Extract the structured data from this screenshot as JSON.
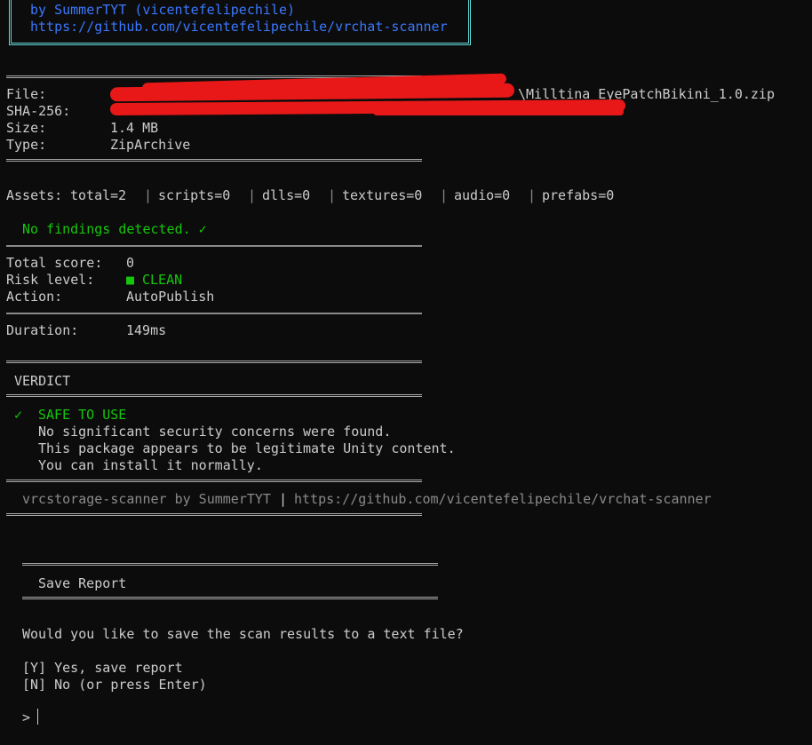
{
  "banner": {
    "author_line": "by SummerTYT (vicentefelipechile)",
    "repo_url": "https://github.com/vicentefelipechile/vrchat-scanner"
  },
  "file_info": {
    "file_label": "File:",
    "file_value": "\\Milltina_EyePatchBikini_1.0.zip",
    "sha_label": "SHA-256:",
    "size_label": "Size:",
    "size_value": "1.4 MB",
    "type_label": "Type:",
    "type_value": "ZipArchive"
  },
  "assets": {
    "label": "Assets:",
    "items": [
      "total=2",
      "scripts=0",
      "dlls=0",
      "textures=0",
      "audio=0",
      "prefabs=0"
    ]
  },
  "findings": {
    "text": "No findings detected. ✓"
  },
  "score": {
    "total_label": "Total score:",
    "total_value": "0",
    "risk_label": "Risk level:",
    "risk_marker": "■",
    "risk_value": "CLEAN",
    "action_label": "Action:",
    "action_value": "AutoPublish",
    "duration_label": "Duration:",
    "duration_value": "149ms"
  },
  "verdict": {
    "heading": "VERDICT",
    "check": "✓",
    "title": "SAFE TO USE",
    "lines": [
      "No significant security concerns were found.",
      "This package appears to be legitimate Unity content.",
      "You can install it normally."
    ]
  },
  "footer": {
    "tool": "vrcstorage-scanner by SummerTYT",
    "separator": "|",
    "url": "https://github.com/vicentefelipechile/vrchat-scanner"
  },
  "save_report": {
    "heading": "Save Report",
    "question": "Would you like to save the scan results to a text file?",
    "option_yes": "[Y] Yes, save report",
    "option_no": "[N] No (or press Enter)",
    "prompt": ">"
  },
  "colors": {
    "background": "#0c0c0c",
    "text": "#cccccc",
    "accent_blue": "#3b78ff",
    "success_green": "#16c60c",
    "banner_border": "#61d6d6",
    "redaction": "#e81818"
  }
}
